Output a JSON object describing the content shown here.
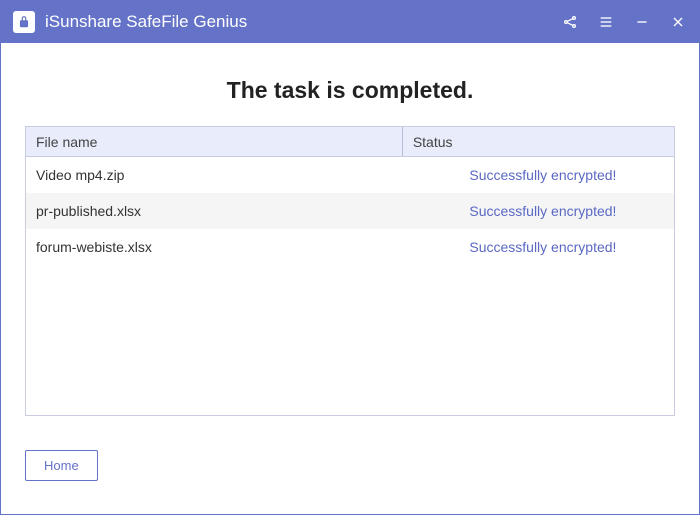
{
  "titlebar": {
    "app_name": "iSunshare SafeFile Genius"
  },
  "main": {
    "heading": "The task is completed.",
    "columns": {
      "file_name": "File name",
      "status": "Status"
    },
    "rows": [
      {
        "name": "Video mp4.zip",
        "status": "Successfully encrypted!"
      },
      {
        "name": "pr-published.xlsx",
        "status": "Successfully encrypted!"
      },
      {
        "name": "forum-webiste.xlsx",
        "status": "Successfully encrypted!"
      }
    ]
  },
  "footer": {
    "home_label": "Home"
  }
}
